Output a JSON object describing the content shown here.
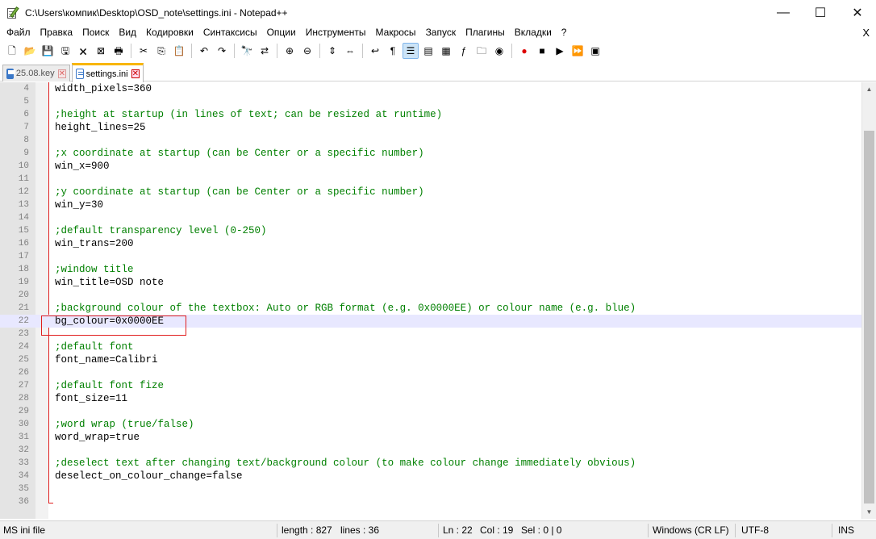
{
  "window": {
    "title": "C:\\Users\\компик\\Desktop\\OSD_note\\settings.ini - Notepad++",
    "minimize": "—",
    "maximize": "☐",
    "close": "✕"
  },
  "menu": {
    "items": [
      "Файл",
      "Правка",
      "Поиск",
      "Вид",
      "Кодировки",
      "Синтаксисы",
      "Опции",
      "Инструменты",
      "Макросы",
      "Запуск",
      "Плагины",
      "Вкладки",
      "?"
    ],
    "close": "X"
  },
  "toolbar": {
    "icons": [
      "new-file-icon",
      "open-file-icon",
      "save-icon",
      "save-all-icon",
      "close-icon",
      "close-all-icon",
      "print-icon",
      "cut-icon",
      "copy-icon",
      "paste-icon",
      "undo-icon",
      "redo-icon",
      "find-icon",
      "replace-icon",
      "zoom-in-icon",
      "zoom-out-icon",
      "sync-vertical-icon",
      "sync-horizontal-icon",
      "word-wrap-icon",
      "show-all-chars-icon",
      "indent-guide-icon",
      "udl-icon",
      "doc-map-icon",
      "function-list-icon",
      "folder-workspace-icon",
      "monitoring-icon",
      "record-macro-icon",
      "stop-macro-icon",
      "play-macro-icon",
      "run-macro-multiple-icon",
      "save-macro-icon"
    ]
  },
  "tabs": [
    {
      "label": "25.08.key",
      "active": false
    },
    {
      "label": "settings.ini",
      "active": true
    }
  ],
  "editor": {
    "current_line": 22,
    "lines": [
      {
        "n": "4",
        "type": "kv",
        "key": "width_pixels",
        "value": "360"
      },
      {
        "n": "5",
        "type": "blank"
      },
      {
        "n": "6",
        "type": "comment",
        "text": ";height at startup (in lines of text; can be resized at runtime)"
      },
      {
        "n": "7",
        "type": "kv",
        "key": "height_lines",
        "value": "25"
      },
      {
        "n": "8",
        "type": "blank"
      },
      {
        "n": "9",
        "type": "comment",
        "text": ";x coordinate at startup (can be Center or a specific number)"
      },
      {
        "n": "10",
        "type": "kv",
        "key": "win_x",
        "value": "900"
      },
      {
        "n": "11",
        "type": "blank"
      },
      {
        "n": "12",
        "type": "comment",
        "text": ";y coordinate at startup (can be Center or a specific number)"
      },
      {
        "n": "13",
        "type": "kv",
        "key": "win_y",
        "value": "30"
      },
      {
        "n": "14",
        "type": "blank"
      },
      {
        "n": "15",
        "type": "comment",
        "text": ";default transparency level (0-250)"
      },
      {
        "n": "16",
        "type": "kv",
        "key": "win_trans",
        "value": "200"
      },
      {
        "n": "17",
        "type": "blank"
      },
      {
        "n": "18",
        "type": "comment",
        "text": ";window title"
      },
      {
        "n": "19",
        "type": "kv",
        "key": "win_title",
        "value": "OSD note"
      },
      {
        "n": "20",
        "type": "blank"
      },
      {
        "n": "21",
        "type": "comment",
        "text": ";background colour of the textbox: Auto or RGB format (e.g. 0x0000EE) or colour name (e.g. blue)"
      },
      {
        "n": "22",
        "type": "kv",
        "key": "bg_colour",
        "value": "0x0000EE"
      },
      {
        "n": "23",
        "type": "blank"
      },
      {
        "n": "24",
        "type": "comment",
        "text": ";default font"
      },
      {
        "n": "25",
        "type": "kv",
        "key": "font_name",
        "value": "Calibri"
      },
      {
        "n": "26",
        "type": "blank"
      },
      {
        "n": "27",
        "type": "comment",
        "text": ";default font fize"
      },
      {
        "n": "28",
        "type": "kv",
        "key": "font_size",
        "value": "11"
      },
      {
        "n": "29",
        "type": "blank"
      },
      {
        "n": "30",
        "type": "comment",
        "text": ";word wrap (true/false)"
      },
      {
        "n": "31",
        "type": "kv",
        "key": "word_wrap",
        "value": "true"
      },
      {
        "n": "32",
        "type": "blank"
      },
      {
        "n": "33",
        "type": "comment",
        "text": ";deselect text after changing text/background colour (to make colour change immediately obvious)"
      },
      {
        "n": "34",
        "type": "kv",
        "key": "deselect_on_colour_change",
        "value": "false"
      },
      {
        "n": "35",
        "type": "blank"
      },
      {
        "n": "36",
        "type": "blank"
      }
    ]
  },
  "status": {
    "language": "MS ini file",
    "length": "length : 827",
    "lines": "lines : 36",
    "ln": "Ln : 22",
    "col": "Col : 19",
    "sel": "Sel : 0 | 0",
    "eol": "Windows (CR LF)",
    "encoding": "UTF-8",
    "mode": "INS"
  },
  "colors": {
    "comment": "#008000",
    "current_line_bg": "#e8e8ff",
    "highlight_box": "#e02020",
    "tab_accent": "#f8b600"
  }
}
